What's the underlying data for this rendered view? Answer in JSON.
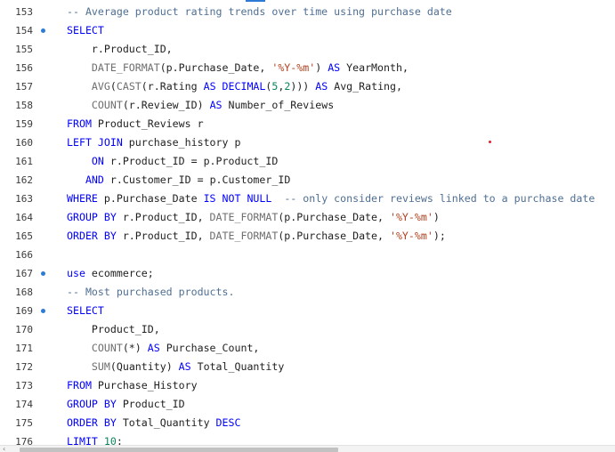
{
  "editor": {
    "accent_color": "#2e7bd6",
    "lines": [
      {
        "num": "153",
        "bp": false,
        "tokens": [
          {
            "t": "cm",
            "v": "-- Average product rating trends over time using purchase date"
          }
        ]
      },
      {
        "num": "154",
        "bp": true,
        "tokens": [
          {
            "t": "kw",
            "v": "SELECT"
          }
        ]
      },
      {
        "num": "155",
        "bp": false,
        "tokens": [
          {
            "t": "txt",
            "v": "    r.Product_ID,"
          }
        ]
      },
      {
        "num": "156",
        "bp": false,
        "tokens": [
          {
            "t": "txt",
            "v": "    "
          },
          {
            "t": "fn",
            "v": "DATE_FORMAT"
          },
          {
            "t": "txt",
            "v": "(p.Purchase_Date, "
          },
          {
            "t": "str",
            "v": "'%Y-%m'"
          },
          {
            "t": "txt",
            "v": ") "
          },
          {
            "t": "kw",
            "v": "AS"
          },
          {
            "t": "txt",
            "v": " YearMonth,"
          }
        ]
      },
      {
        "num": "157",
        "bp": false,
        "tokens": [
          {
            "t": "txt",
            "v": "    "
          },
          {
            "t": "fn",
            "v": "AVG"
          },
          {
            "t": "txt",
            "v": "("
          },
          {
            "t": "fn",
            "v": "CAST"
          },
          {
            "t": "txt",
            "v": "(r.Rating "
          },
          {
            "t": "kw",
            "v": "AS DECIMAL"
          },
          {
            "t": "txt",
            "v": "("
          },
          {
            "t": "num",
            "v": "5"
          },
          {
            "t": "txt",
            "v": ","
          },
          {
            "t": "num",
            "v": "2"
          },
          {
            "t": "txt",
            "v": "))) "
          },
          {
            "t": "kw",
            "v": "AS"
          },
          {
            "t": "txt",
            "v": " Avg_Rating,"
          }
        ]
      },
      {
        "num": "158",
        "bp": false,
        "tokens": [
          {
            "t": "txt",
            "v": "    "
          },
          {
            "t": "fn",
            "v": "COUNT"
          },
          {
            "t": "txt",
            "v": "(r.Review_ID) "
          },
          {
            "t": "kw",
            "v": "AS"
          },
          {
            "t": "txt",
            "v": " Number_of_Reviews"
          }
        ]
      },
      {
        "num": "159",
        "bp": false,
        "tokens": [
          {
            "t": "kw",
            "v": "FROM"
          },
          {
            "t": "txt",
            "v": " Product_Reviews r"
          }
        ]
      },
      {
        "num": "160",
        "bp": false,
        "tokens": [
          {
            "t": "kw",
            "v": "LEFT JOIN"
          },
          {
            "t": "txt",
            "v": " purchase_history p"
          }
        ]
      },
      {
        "num": "161",
        "bp": false,
        "tokens": [
          {
            "t": "txt",
            "v": "    "
          },
          {
            "t": "kw",
            "v": "ON"
          },
          {
            "t": "txt",
            "v": " r.Product_ID = p.Product_ID"
          }
        ]
      },
      {
        "num": "162",
        "bp": false,
        "tokens": [
          {
            "t": "txt",
            "v": "   "
          },
          {
            "t": "kw",
            "v": "AND"
          },
          {
            "t": "txt",
            "v": " r.Customer_ID = p.Customer_ID"
          }
        ]
      },
      {
        "num": "163",
        "bp": false,
        "tokens": [
          {
            "t": "kw",
            "v": "WHERE"
          },
          {
            "t": "txt",
            "v": " p.Purchase_Date "
          },
          {
            "t": "kw",
            "v": "IS NOT NULL"
          },
          {
            "t": "txt",
            "v": "  "
          },
          {
            "t": "cm",
            "v": "-- only consider reviews linked to a purchase date"
          }
        ]
      },
      {
        "num": "164",
        "bp": false,
        "tokens": [
          {
            "t": "kw",
            "v": "GROUP BY"
          },
          {
            "t": "txt",
            "v": " r.Product_ID, "
          },
          {
            "t": "fn",
            "v": "DATE_FORMAT"
          },
          {
            "t": "txt",
            "v": "(p.Purchase_Date, "
          },
          {
            "t": "str",
            "v": "'%Y-%m'"
          },
          {
            "t": "txt",
            "v": ")"
          }
        ]
      },
      {
        "num": "165",
        "bp": false,
        "tokens": [
          {
            "t": "kw",
            "v": "ORDER BY"
          },
          {
            "t": "txt",
            "v": " r.Product_ID, "
          },
          {
            "t": "fn",
            "v": "DATE_FORMAT"
          },
          {
            "t": "txt",
            "v": "(p.Purchase_Date, "
          },
          {
            "t": "str",
            "v": "'%Y-%m'"
          },
          {
            "t": "txt",
            "v": ");"
          }
        ]
      },
      {
        "num": "166",
        "bp": false,
        "tokens": []
      },
      {
        "num": "167",
        "bp": true,
        "tokens": [
          {
            "t": "kw",
            "v": "use"
          },
          {
            "t": "txt",
            "v": " ecommerce;"
          }
        ]
      },
      {
        "num": "168",
        "bp": false,
        "tokens": [
          {
            "t": "cm",
            "v": "-- Most purchased products."
          }
        ]
      },
      {
        "num": "169",
        "bp": true,
        "tokens": [
          {
            "t": "kw",
            "v": "SELECT"
          }
        ]
      },
      {
        "num": "170",
        "bp": false,
        "tokens": [
          {
            "t": "txt",
            "v": "    Product_ID,"
          }
        ]
      },
      {
        "num": "171",
        "bp": false,
        "tokens": [
          {
            "t": "txt",
            "v": "    "
          },
          {
            "t": "fn",
            "v": "COUNT"
          },
          {
            "t": "txt",
            "v": "(*) "
          },
          {
            "t": "kw",
            "v": "AS"
          },
          {
            "t": "txt",
            "v": " Purchase_Count,"
          }
        ]
      },
      {
        "num": "172",
        "bp": false,
        "tokens": [
          {
            "t": "txt",
            "v": "    "
          },
          {
            "t": "fn",
            "v": "SUM"
          },
          {
            "t": "txt",
            "v": "(Quantity) "
          },
          {
            "t": "kw",
            "v": "AS"
          },
          {
            "t": "txt",
            "v": " Total_Quantity"
          }
        ]
      },
      {
        "num": "173",
        "bp": false,
        "tokens": [
          {
            "t": "kw",
            "v": "FROM"
          },
          {
            "t": "txt",
            "v": " Purchase_History"
          }
        ]
      },
      {
        "num": "174",
        "bp": false,
        "tokens": [
          {
            "t": "kw",
            "v": "GROUP BY"
          },
          {
            "t": "txt",
            "v": " Product_ID"
          }
        ]
      },
      {
        "num": "175",
        "bp": false,
        "tokens": [
          {
            "t": "kw",
            "v": "ORDER BY"
          },
          {
            "t": "txt",
            "v": " Total_Quantity "
          },
          {
            "t": "kw",
            "v": "DESC"
          }
        ]
      },
      {
        "num": "176",
        "bp": false,
        "tokens": [
          {
            "t": "kw",
            "v": "LIMIT"
          },
          {
            "t": "txt",
            "v": " "
          },
          {
            "t": "num",
            "v": "10"
          },
          {
            "t": "txt",
            "v": ";"
          }
        ]
      }
    ]
  },
  "scrollbar": {
    "left_arrow_icon": "chevron-left-icon",
    "left_arrow_glyph": "‹"
  }
}
